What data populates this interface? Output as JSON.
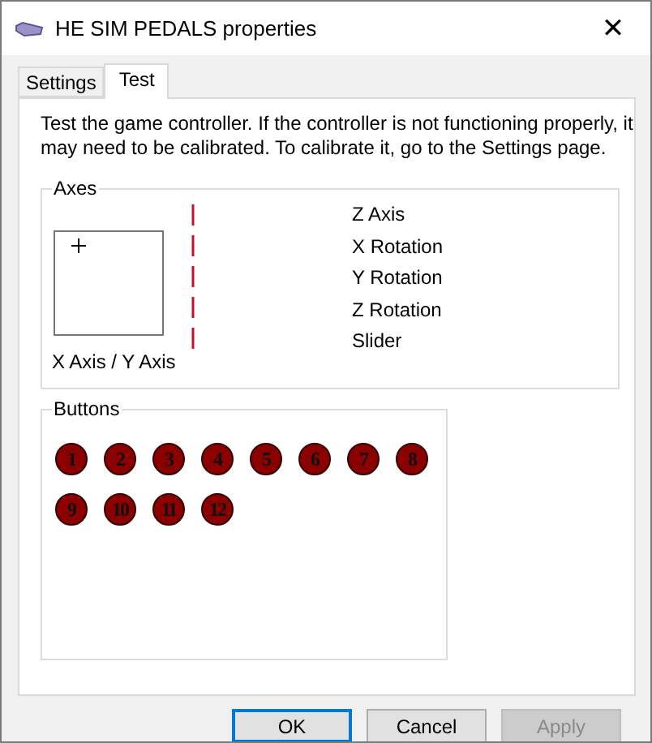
{
  "window": {
    "title": "HE SIM PEDALS properties",
    "close": "✕"
  },
  "tabs": [
    {
      "label": "Settings",
      "selected": false
    },
    {
      "label": "Test",
      "selected": true
    }
  ],
  "intro": "Test the game controller.  If the controller is not functioning properly, it may need to be calibrated.  To calibrate it, go to the Settings page.",
  "axes": {
    "title": "Axes",
    "xy_label": "X Axis / Y Axis",
    "labels": [
      "Z Axis",
      "X Rotation",
      "Y Rotation",
      "Z Rotation",
      "Slider"
    ]
  },
  "buttons_group": {
    "title": "Buttons",
    "buttons": [
      "1",
      "2",
      "3",
      "4",
      "5",
      "6",
      "7",
      "8",
      "9",
      "10",
      "11",
      "12"
    ]
  },
  "footer": [
    {
      "label": "OK",
      "default": true,
      "disabled": false
    },
    {
      "label": "Cancel",
      "default": false,
      "disabled": false
    },
    {
      "label": "Apply",
      "default": false,
      "disabled": true
    }
  ]
}
